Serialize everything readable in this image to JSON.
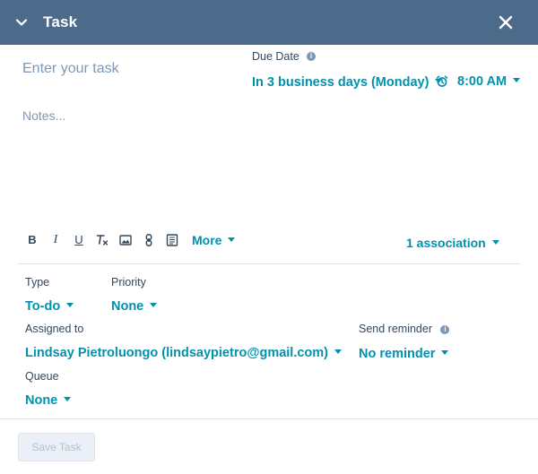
{
  "header": {
    "title": "Task"
  },
  "task": {
    "placeholder": "Enter your task"
  },
  "due": {
    "label": "Due Date",
    "date_value": "In 3 business days (Monday)",
    "time_value": "8:00 AM"
  },
  "notes": {
    "placeholder": "Notes..."
  },
  "toolbar": {
    "bold": "B",
    "italic": "I",
    "underline": "U",
    "more_label": "More",
    "association_label": "1 association"
  },
  "fields": {
    "type_label": "Type",
    "type_value": "To-do",
    "priority_label": "Priority",
    "priority_value": "None",
    "assigned_label": "Assigned to",
    "assigned_value": "Lindsay Pietroluongo (lindsaypietro@gmail.com)",
    "reminder_label": "Send reminder",
    "reminder_value": "No reminder",
    "queue_label": "Queue",
    "queue_value": "None"
  },
  "footer": {
    "save_label": "Save Task"
  },
  "colors": {
    "header_bg": "#4c6b8b",
    "link": "#0091ae",
    "text": "#33475b",
    "placeholder": "#7c98b6"
  }
}
